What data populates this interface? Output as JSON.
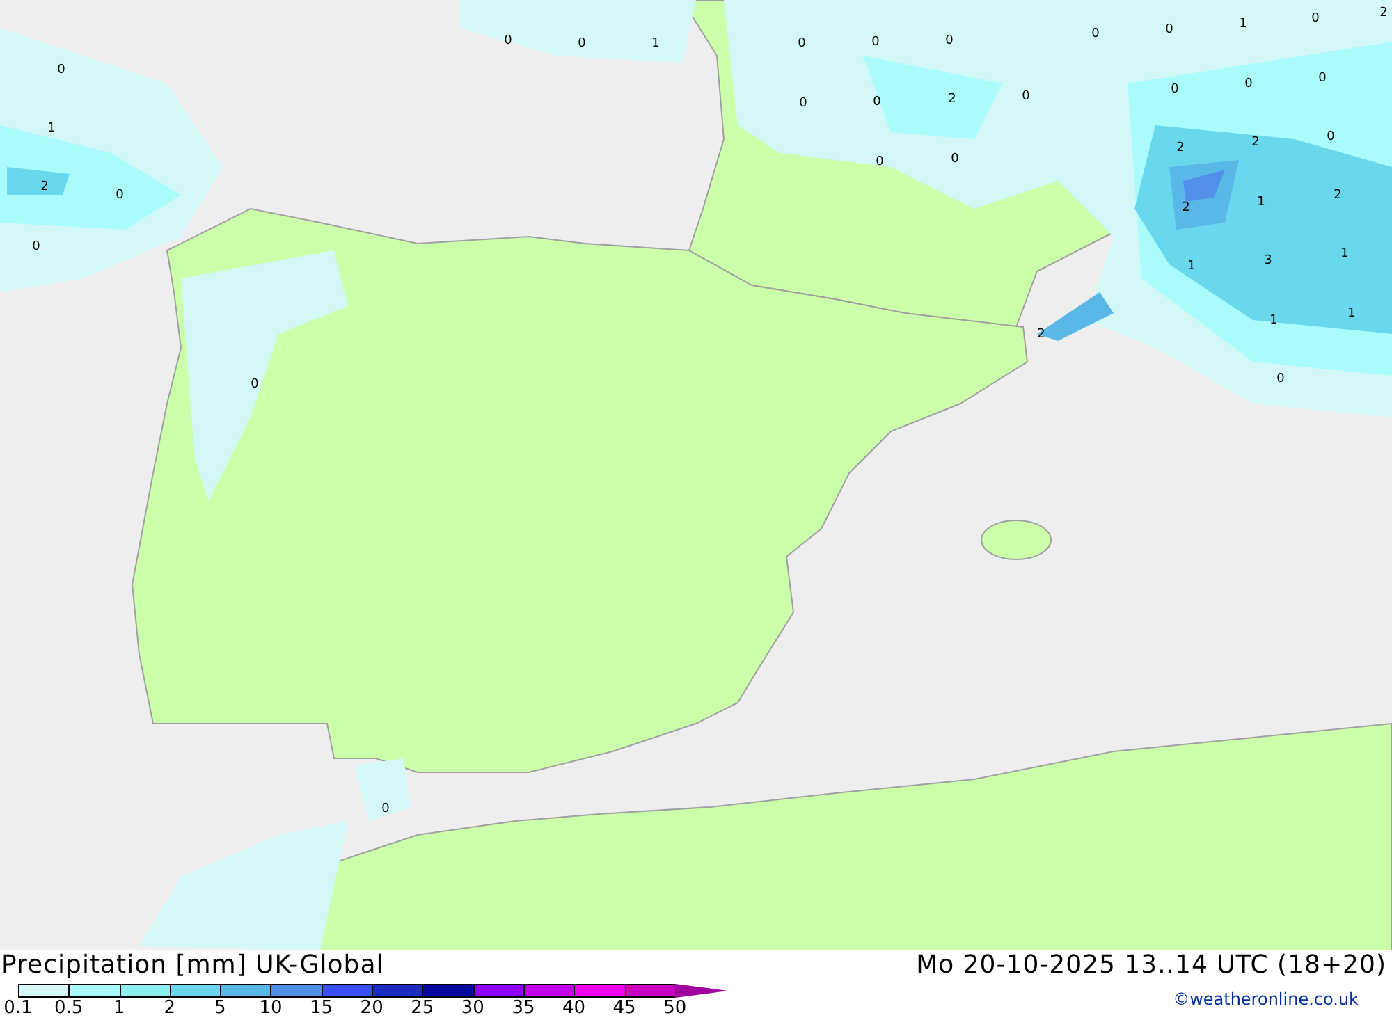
{
  "map": {
    "value_labels": [
      "0",
      "0",
      "1",
      "0",
      "1",
      "2",
      "0",
      "0",
      "0",
      "0",
      "0",
      "0",
      "0",
      "0",
      "0",
      "1",
      "0",
      "2",
      "0",
      "0",
      "2",
      "0",
      "0",
      "0",
      "0",
      "0",
      "0",
      "2",
      "2",
      "0",
      "2",
      "1",
      "2",
      "1",
      "3",
      "1",
      "2",
      "1",
      "1",
      "0"
    ]
  },
  "footer": {
    "title": "Precipitation [mm] UK-Global",
    "datetime": "Mo 20-10-2025 13..14 UTC (18+20)",
    "credit": "©weatheronline.co.uk"
  },
  "legend": {
    "items": [
      {
        "label": "0.1",
        "color": "#d4f8f8",
        "kind": "box"
      },
      {
        "label": "0.5",
        "color": "#aafcfc",
        "kind": "box"
      },
      {
        "label": "1",
        "color": "#8ceeee",
        "kind": "box"
      },
      {
        "label": "2",
        "color": "#6ad8ec",
        "kind": "box"
      },
      {
        "label": "5",
        "color": "#5ab8e8",
        "kind": "box"
      },
      {
        "label": "10",
        "color": "#5090e8",
        "kind": "box"
      },
      {
        "label": "15",
        "color": "#3850f4",
        "kind": "box"
      },
      {
        "label": "20",
        "color": "#1c2cc0",
        "kind": "box"
      },
      {
        "label": "25",
        "color": "#0808a0",
        "kind": "box"
      },
      {
        "label": "30",
        "color": "#9000f8",
        "kind": "box"
      },
      {
        "label": "35",
        "color": "#c000e8",
        "kind": "box"
      },
      {
        "label": "40",
        "color": "#f000f0",
        "kind": "box"
      },
      {
        "label": "45",
        "color": "#c800c0",
        "kind": "box"
      },
      {
        "label": "50",
        "color": "#a000a0",
        "kind": "arrow"
      }
    ]
  }
}
